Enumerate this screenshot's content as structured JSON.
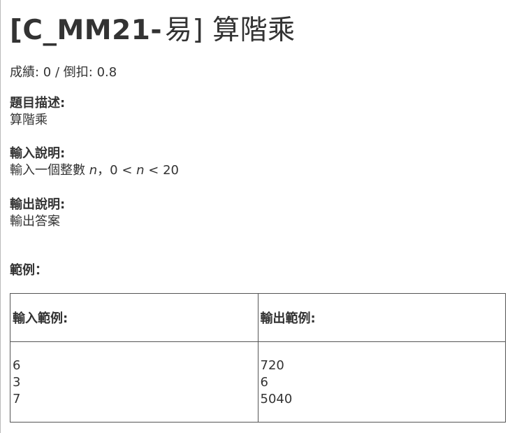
{
  "problem": {
    "code": "[C_MM21-",
    "title_rest": "易] 算階乘",
    "score_label": "成績: ",
    "score_value": "0",
    "separator": " / ",
    "deduct_label": "倒扣: ",
    "deduct_value": "0.8"
  },
  "description": {
    "heading": "題目描述:",
    "body": "算階乘"
  },
  "input": {
    "heading": "輸入說明:",
    "body_prefix": "輸入一個整數 ",
    "var1": "n",
    "body_middle": "，0 < ",
    "var2": "n",
    "body_suffix": " < 20"
  },
  "output": {
    "heading": "輸出說明:",
    "body": "輸出答案"
  },
  "examples": {
    "heading": "範例：",
    "input_header": "輸入範例:",
    "output_header": "輸出範例:",
    "input_lines": [
      "6",
      "3",
      "7"
    ],
    "output_lines": [
      "720",
      "6",
      "5040"
    ]
  }
}
